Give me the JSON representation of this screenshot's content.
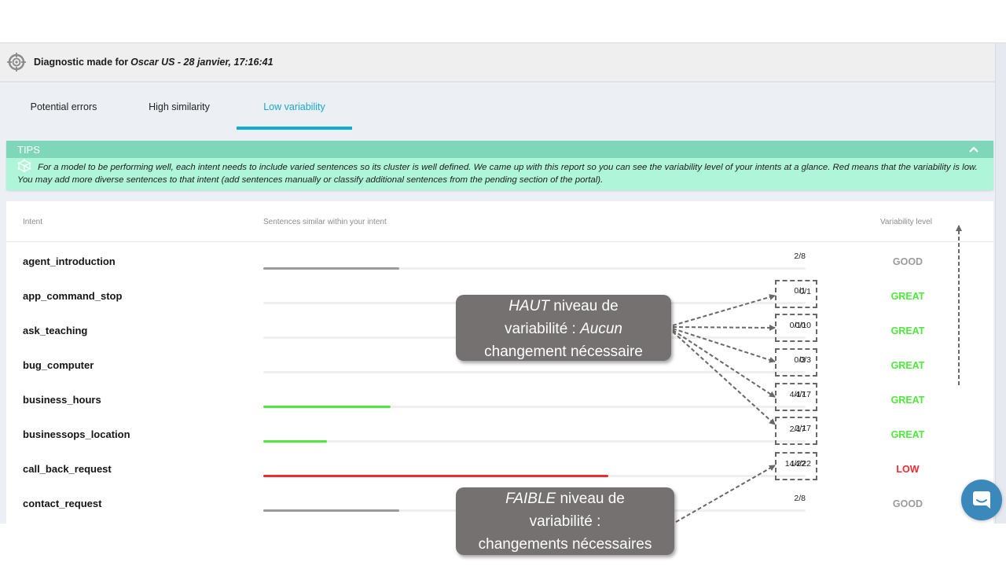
{
  "header": {
    "icon": "target-icon",
    "title_prefix": "Diagnostic made for",
    "title_subject": "Oscar US - 28 janvier, 17:16:41"
  },
  "tabs": [
    {
      "label": "Potential errors",
      "active": false
    },
    {
      "label": "High similarity",
      "active": false
    },
    {
      "label": "Low variability",
      "active": true
    }
  ],
  "tips": {
    "title": "TIPS",
    "icon": "network-cube-icon",
    "collapse_icon": "chevron-up-icon",
    "text": "For a model to be performing well, each intent needs to include varied sentences so its cluster is well defined. We came up with this report so you can see the variability level of your intents at a glance. Red means that the variability is low. You may add more diverse sentences to that intent (add sentences manually or classify additional sentences from the pending section of the portal)."
  },
  "table": {
    "columns": {
      "intent": "Intent",
      "similar": "Sentences similar within your intent",
      "level": "Variability level"
    },
    "rows": [
      {
        "intent": "agent_introduction",
        "similar": 2,
        "total": 8,
        "count": "2/8",
        "level": "GOOD",
        "status": "good"
      },
      {
        "intent": "app_command_stop",
        "similar": 0,
        "total": 1,
        "count": "0/1",
        "level": "GREAT",
        "status": "great"
      },
      {
        "intent": "ask_teaching",
        "similar": 0,
        "total": 10,
        "count": "0/10",
        "level": "GREAT",
        "status": "great"
      },
      {
        "intent": "bug_computer",
        "similar": 0,
        "total": 3,
        "count": "0/3",
        "level": "GREAT",
        "status": "great"
      },
      {
        "intent": "business_hours",
        "similar": 4,
        "total": 17,
        "count": "4/17",
        "level": "GREAT",
        "status": "great"
      },
      {
        "intent": "businessops_location",
        "similar": 2,
        "total": 17,
        "count": "2/17",
        "level": "GREAT",
        "status": "great"
      },
      {
        "intent": "call_back_request",
        "similar": 14,
        "total": 22,
        "count": "14/22",
        "level": "LOW",
        "status": "low"
      },
      {
        "intent": "contact_request",
        "similar": 2,
        "total": 8,
        "count": "2/8",
        "level": "GOOD",
        "status": "good"
      }
    ]
  },
  "colors": {
    "accent": "#10acd3",
    "tips_header": "#7fd7b9",
    "tips_body": "#aef5d9",
    "great": "#4fe83d",
    "good": "#9b9b9b",
    "low": "#ee2b2f",
    "callout": "#757170",
    "chat": "#3b88bb"
  },
  "annotations": {
    "high": {
      "emph": "HAUT",
      "line1_rest": " niveau de",
      "line2_plain": "variabilité : ",
      "line2_emph": "Aucun",
      "line3": "changement nécessaire"
    },
    "low": {
      "emph": "FAIBLE",
      "line1_rest": " niveau de",
      "line2": "variabilité :",
      "line3": "changements nécessaires"
    }
  },
  "chat": {
    "icon": "chat-bubble-icon"
  }
}
